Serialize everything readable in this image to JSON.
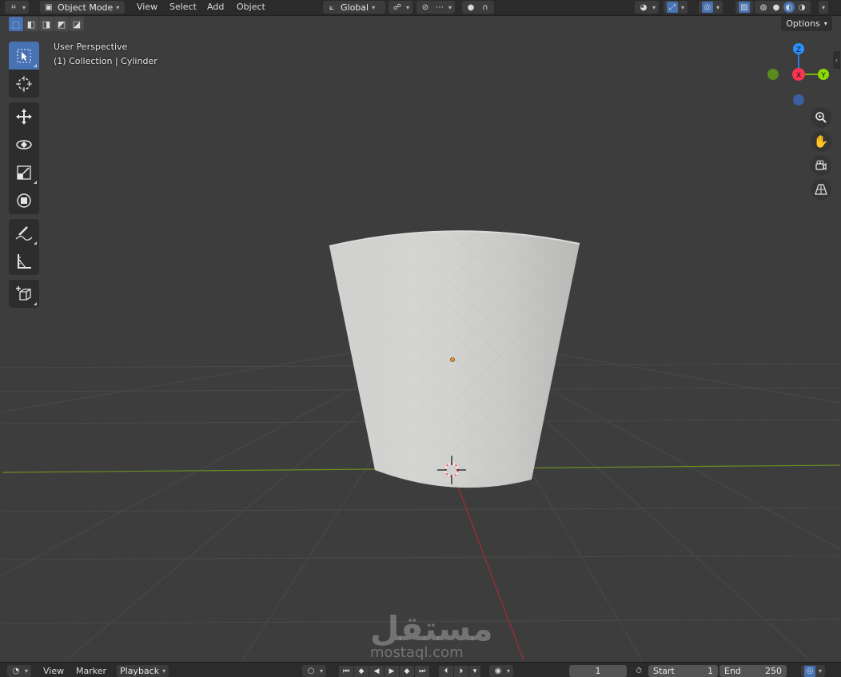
{
  "header": {
    "mode": "Object Mode",
    "menus": [
      "View",
      "Select",
      "Add",
      "Object"
    ],
    "orientation": "Global"
  },
  "viewport": {
    "view_name": "User Perspective",
    "collection_info": "(1) Collection | Cylinder",
    "options_label": "Options",
    "gizmo": {
      "z": "Z",
      "x": "X",
      "y": "Y"
    }
  },
  "toolbar": {
    "tools": [
      "select-box",
      "cursor",
      "move",
      "rotate",
      "scale",
      "transform",
      "annotate",
      "measure",
      "add-cube"
    ]
  },
  "timeline": {
    "menus": [
      "View",
      "Marker",
      "Playback"
    ],
    "current_frame": "1",
    "start_label": "Start",
    "start_value": "1",
    "end_label": "End",
    "end_value": "250"
  },
  "watermark": {
    "arabic": "مستقل",
    "site": "mostaql.com"
  },
  "colors": {
    "accent": "#4772b3",
    "background": "#3d3d3d",
    "axis_x": "#ff3352",
    "axis_y": "#8bdc00",
    "axis_z": "#2890ff"
  }
}
